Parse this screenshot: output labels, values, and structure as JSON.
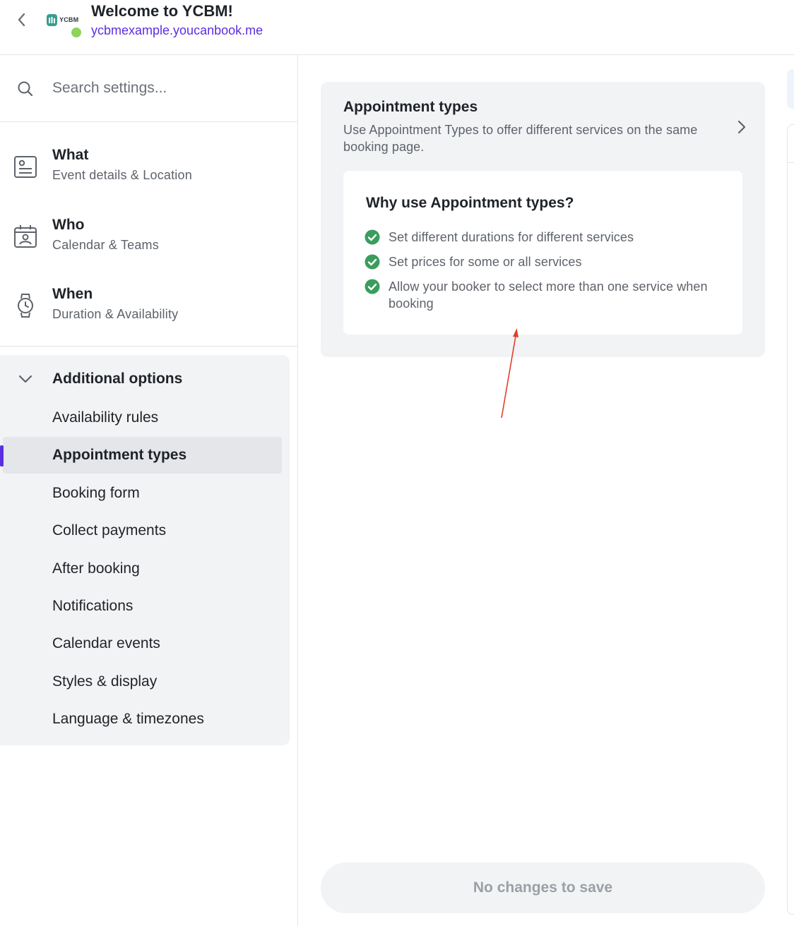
{
  "header": {
    "title": "Welcome to YCBM!",
    "link": "ycbmexample.youcanbook.me",
    "logo_text": "YCBM",
    "status_color": "#8ed35c"
  },
  "sidebar": {
    "search": {
      "placeholder": "Search settings..."
    },
    "nav": [
      {
        "title": "What",
        "subtitle": "Event details & Location",
        "icon": "document-icon"
      },
      {
        "title": "Who",
        "subtitle": "Calendar & Teams",
        "icon": "calendar-person-icon"
      },
      {
        "title": "When",
        "subtitle": "Duration & Availability",
        "icon": "watch-icon"
      }
    ],
    "additional_options": {
      "title": "Additional options",
      "items": [
        "Availability rules",
        "Appointment types",
        "Booking form",
        "Collect payments",
        "After booking",
        "Notifications",
        "Calendar events",
        "Styles & display",
        "Language & timezones"
      ],
      "active_index": 1
    }
  },
  "main": {
    "card": {
      "title": "Appointment types",
      "description": "Use Appointment Types to offer different services on the same booking page.",
      "info": {
        "title": "Why use Appointment types?",
        "benefits": [
          "Set different durations for different services",
          "Set prices for some or all services",
          "Allow your booker to select more than one service when booking"
        ]
      }
    },
    "save_button": "No changes to save"
  },
  "colors": {
    "accent": "#5b2ee0",
    "check": "#3a9d5d",
    "annotation_arrow": "#e0412b"
  }
}
